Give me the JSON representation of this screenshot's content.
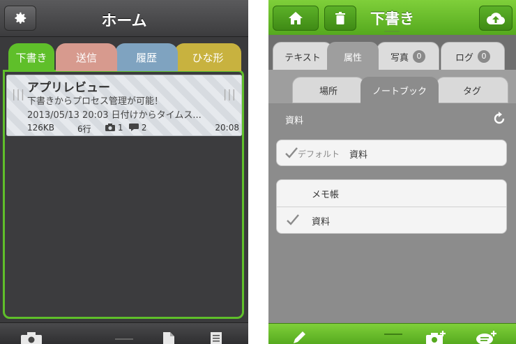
{
  "left": {
    "header": {
      "title": "ホーム",
      "settings_icon": "gear-icon"
    },
    "tabs": [
      {
        "label": "下書き",
        "color": "#5fbf2a"
      },
      {
        "label": "送信",
        "color": "#d79a8e"
      },
      {
        "label": "履歴",
        "color": "#7fa3c0"
      },
      {
        "label": "ひな形",
        "color": "#c8b23f"
      }
    ],
    "draft": {
      "title": "アプリレビュー",
      "line1": "下書きからプロセス管理が可能！",
      "line2": "2013/05/13 20:03 日付けからタイムス...",
      "size": "126KB",
      "lines": "6行",
      "photos": "1",
      "comments": "2",
      "time": "20:08"
    },
    "bottom_icons": [
      "camera-icon",
      "document-icon",
      "notes-icon"
    ]
  },
  "right": {
    "header": {
      "title": "下書き",
      "accent": "#5fbf2a"
    },
    "tabs": [
      {
        "label": "テキスト"
      },
      {
        "label": "属性"
      },
      {
        "label": "写真",
        "count": "0"
      },
      {
        "label": "ログ",
        "count": "0"
      }
    ],
    "subtabs": [
      {
        "label": "場所"
      },
      {
        "label": "ノートブック"
      },
      {
        "label": "タグ"
      }
    ],
    "section_label": "資料",
    "default_row": {
      "prefix": "デフォルト",
      "value": "資料"
    },
    "notebooks": [
      {
        "label": "メモ帳",
        "checked": false
      },
      {
        "label": "資料",
        "checked": true
      }
    ],
    "bottom_icons": [
      "pencil-icon",
      "add-photo-icon",
      "add-comment-icon"
    ]
  }
}
